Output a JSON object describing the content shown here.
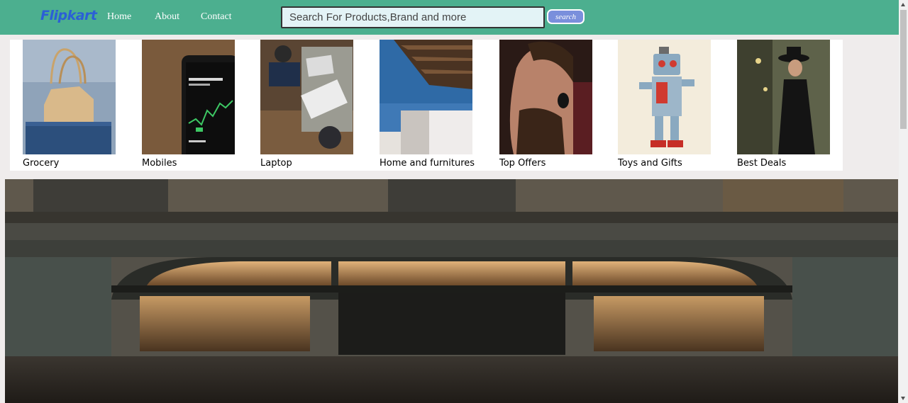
{
  "header": {
    "logo": "Flipkart",
    "nav": [
      {
        "label": "Home"
      },
      {
        "label": "About"
      },
      {
        "label": "Contact"
      }
    ],
    "search": {
      "placeholder": "Search For Products,Brand and more",
      "button_label": "search"
    }
  },
  "categories": [
    {
      "label": "Grocery",
      "icon": "shopping-bag-photo"
    },
    {
      "label": "Mobiles",
      "icon": "smartphone-photo"
    },
    {
      "label": "Laptop",
      "icon": "laptop-desk-photo"
    },
    {
      "label": "Home and furnitures",
      "icon": "house-photo"
    },
    {
      "label": "Top Offers",
      "icon": "earbuds-photo"
    },
    {
      "label": "Toys and Gifts",
      "icon": "toy-robot-photo"
    },
    {
      "label": "Best Deals",
      "icon": "fashion-model-photo"
    }
  ],
  "banner": {
    "icon": "storefront-photo"
  },
  "colors": {
    "nav_bg": "#4caf8f",
    "logo": "#2b5fd6",
    "search_button": "#7a8fdc",
    "page_bg": "#efecec"
  }
}
